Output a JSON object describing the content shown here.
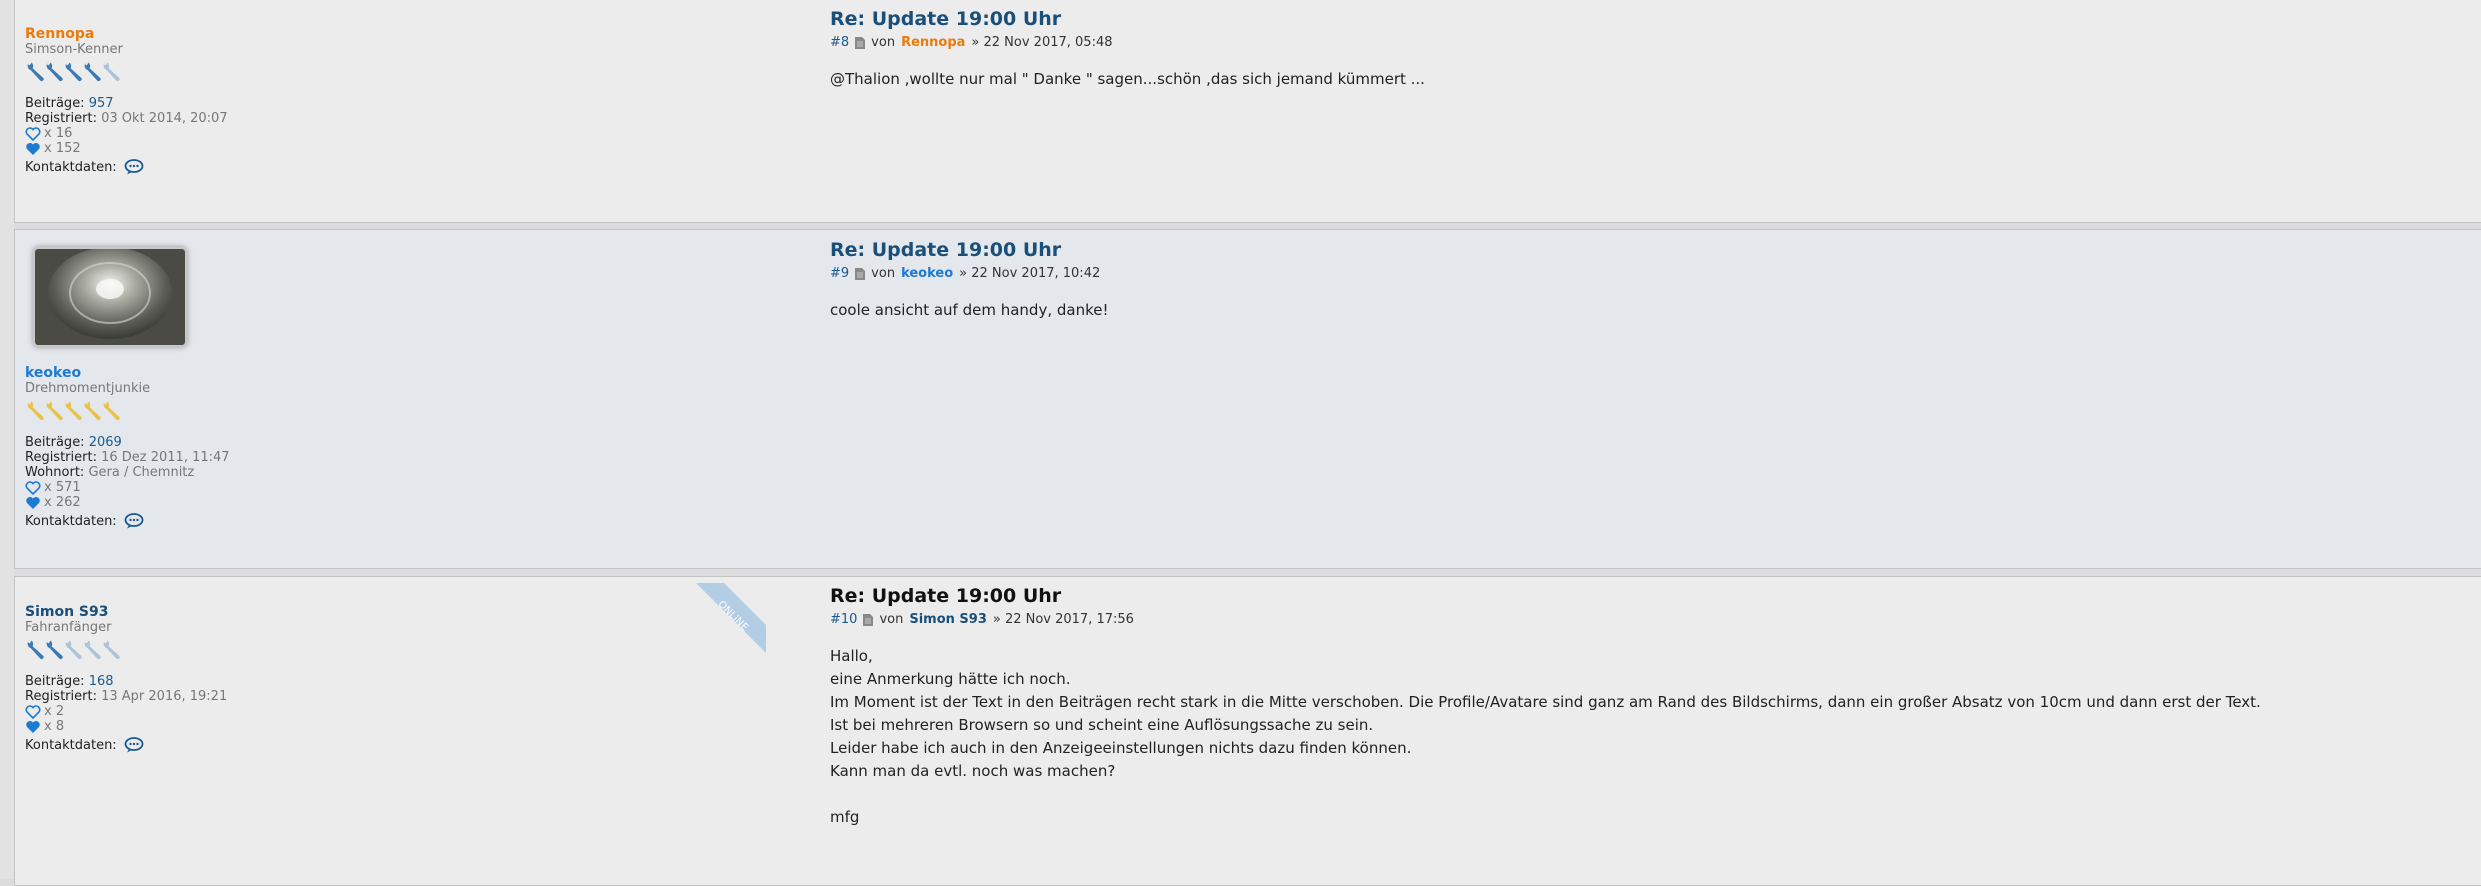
{
  "posts": [
    {
      "title": "Re: Update 19:00 Uhr",
      "number": "#8",
      "by": "von",
      "author": "Rennopa",
      "date": "» 22 Nov 2017, 05:48",
      "content": [
        "@Thalion ,wollte nur mal \" Danke \" sagen...schön ,das sich jemand kümmert ..."
      ],
      "profile": {
        "username": "Rennopa",
        "rank": "Simson-Kenner",
        "wrench_color": "#3a7ab5",
        "wrench_rating": "4 of 5",
        "stats": [
          {
            "label": "Beiträge:",
            "value": "957"
          },
          {
            "label": "Registriert:",
            "value": "03 Okt 2014, 20:07"
          }
        ],
        "likes_given": "x 16",
        "likes_received": "x 152",
        "contact_label": "Kontaktdaten:"
      }
    },
    {
      "title": "Re: Update 19:00 Uhr",
      "number": "#9",
      "by": "von",
      "author": "keokeo",
      "date": "» 22 Nov 2017, 10:42",
      "content": [
        "coole ansicht auf dem handy, danke!"
      ],
      "profile": {
        "username": "keokeo",
        "rank": "Drehmomentjunkie",
        "wrench_color": "#e8c24a",
        "wrench_rating": "5 of 5",
        "stats": [
          {
            "label": "Beiträge:",
            "value": "2069"
          },
          {
            "label": "Registriert:",
            "value": "16 Dez 2011, 11:47"
          },
          {
            "label": "Wohnort:",
            "value": "Gera / Chemnitz"
          }
        ],
        "likes_given": "x 571",
        "likes_received": "x 262",
        "contact_label": "Kontaktdaten:"
      }
    },
    {
      "title": "Re: Update 19:00 Uhr",
      "number": "#10",
      "by": "von",
      "author": "Simon S93",
      "date": "» 22 Nov 2017, 17:56",
      "content": [
        "Hallo,",
        "eine Anmerkung hätte ich noch.",
        "Im Moment ist der Text in den Beiträgen recht stark in die Mitte verschoben. Die Profile/Avatare sind ganz am Rand des Bildschirms, dann ein großer Absatz von 10cm und dann erst der Text.",
        "Ist bei mehreren Browsern so und scheint eine Auflösungssache zu sein.",
        "Leider habe ich auch in den Anzeigeeinstellungen nichts dazu finden können.",
        "Kann man da evtl. noch was machen?",
        "",
        "mfg"
      ],
      "online_badge": "ONLINE",
      "profile": {
        "username": "Simon S93",
        "rank": "Fahranfänger",
        "wrench_color": "#3a7ab5",
        "wrench_rating": "2 of 5",
        "stats": [
          {
            "label": "Beiträge:",
            "value": "168"
          },
          {
            "label": "Registriert:",
            "value": "13 Apr 2016, 19:21"
          }
        ],
        "likes_given": "x 2",
        "likes_received": "x 8",
        "contact_label": "Kontaktdaten:"
      }
    }
  ],
  "colors": {
    "title_link": "#1a4f7a",
    "heart": "#1c7ad0",
    "orange_user": "#ec7a0d",
    "blue_user": "#1c7ad0",
    "navy_user": "#1a4f7a"
  }
}
